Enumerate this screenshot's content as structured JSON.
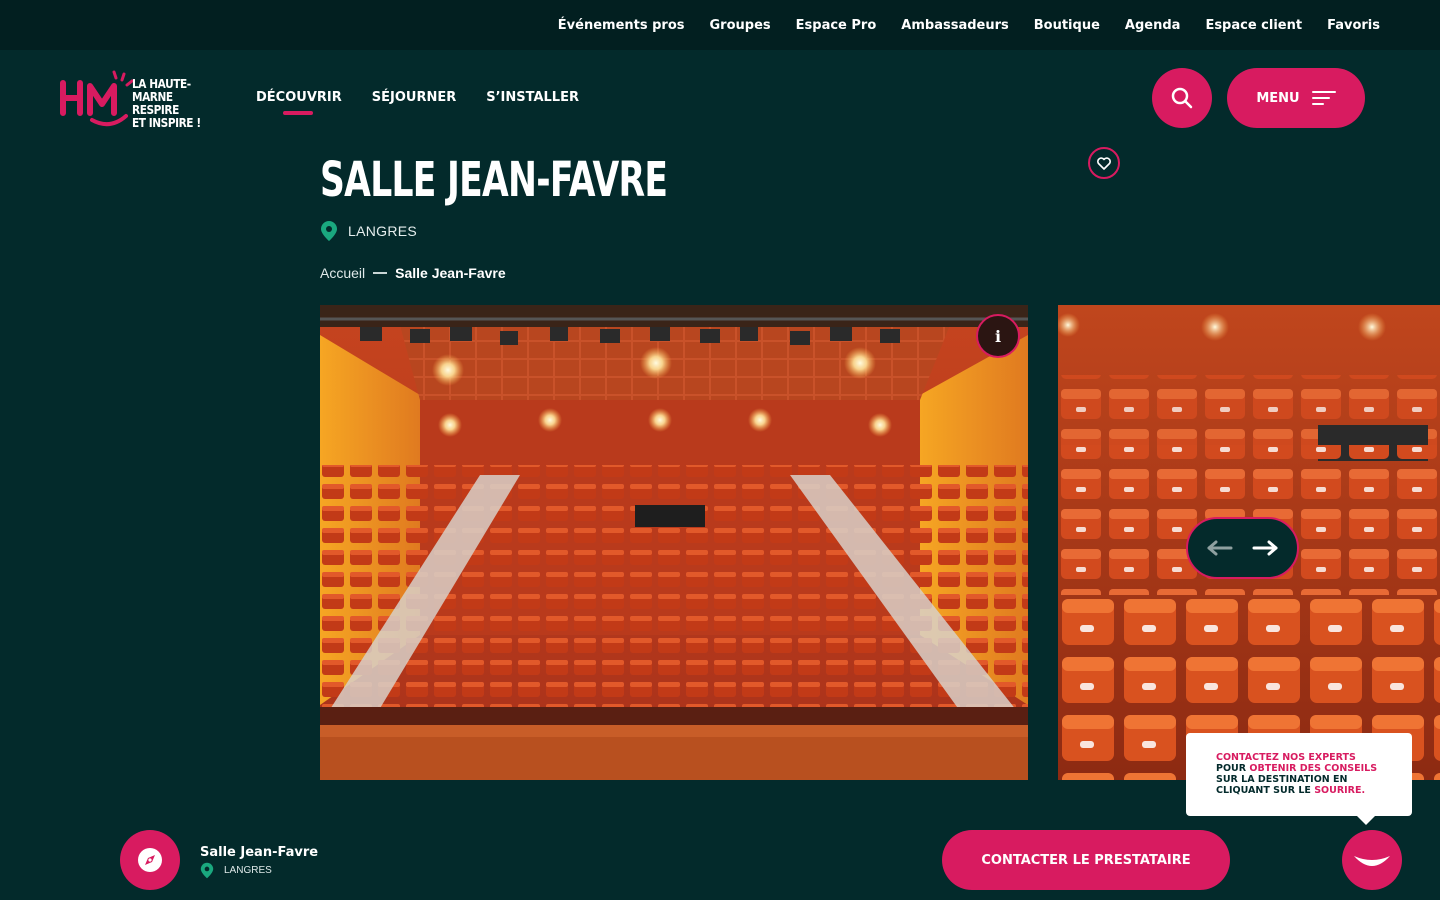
{
  "topbar": {
    "links": [
      "Événements pros",
      "Groupes",
      "Espace Pro",
      "Ambassadeurs",
      "Boutique",
      "Agenda",
      "Espace client",
      "Favoris"
    ]
  },
  "header": {
    "logo_text": "LA HAUTE-MARNE\nRESPIRE\nET INSPIRE !",
    "nav": [
      "DÉCOUVRIR",
      "SÉJOURNER",
      "S’INSTALLER"
    ],
    "active_nav": "DÉCOUVRIR",
    "menu_label": "MENU"
  },
  "page": {
    "title": "Salle Jean-Favre",
    "location": "LANGRES"
  },
  "breadcrumb": {
    "home": "Accueil",
    "current": "Salle Jean-Favre"
  },
  "gallery": {
    "info_label": "i"
  },
  "tooltip": {
    "line1_pink": "Contactez nos experts",
    "line2_a": "pour ",
    "line2_pink": "obtenir des conseils",
    "line3": "sur la destination en",
    "line4_a": "cliquant sur le ",
    "line4_pink": "sourire."
  },
  "bottom": {
    "title": "Salle Jean-Favre",
    "location": "LANGRES",
    "contact_label": "CONTACTER LE PRESTATAIRE"
  },
  "colors": {
    "accent": "#d81b60",
    "background": "#032a2b",
    "topbar": "#021f20",
    "pin": "#1aa87f"
  },
  "icons": [
    "search-icon",
    "hamburger-icon",
    "heart-icon",
    "location-pin-icon",
    "info-icon",
    "arrow-left-icon",
    "arrow-right-icon",
    "compass-icon",
    "smile-icon"
  ]
}
